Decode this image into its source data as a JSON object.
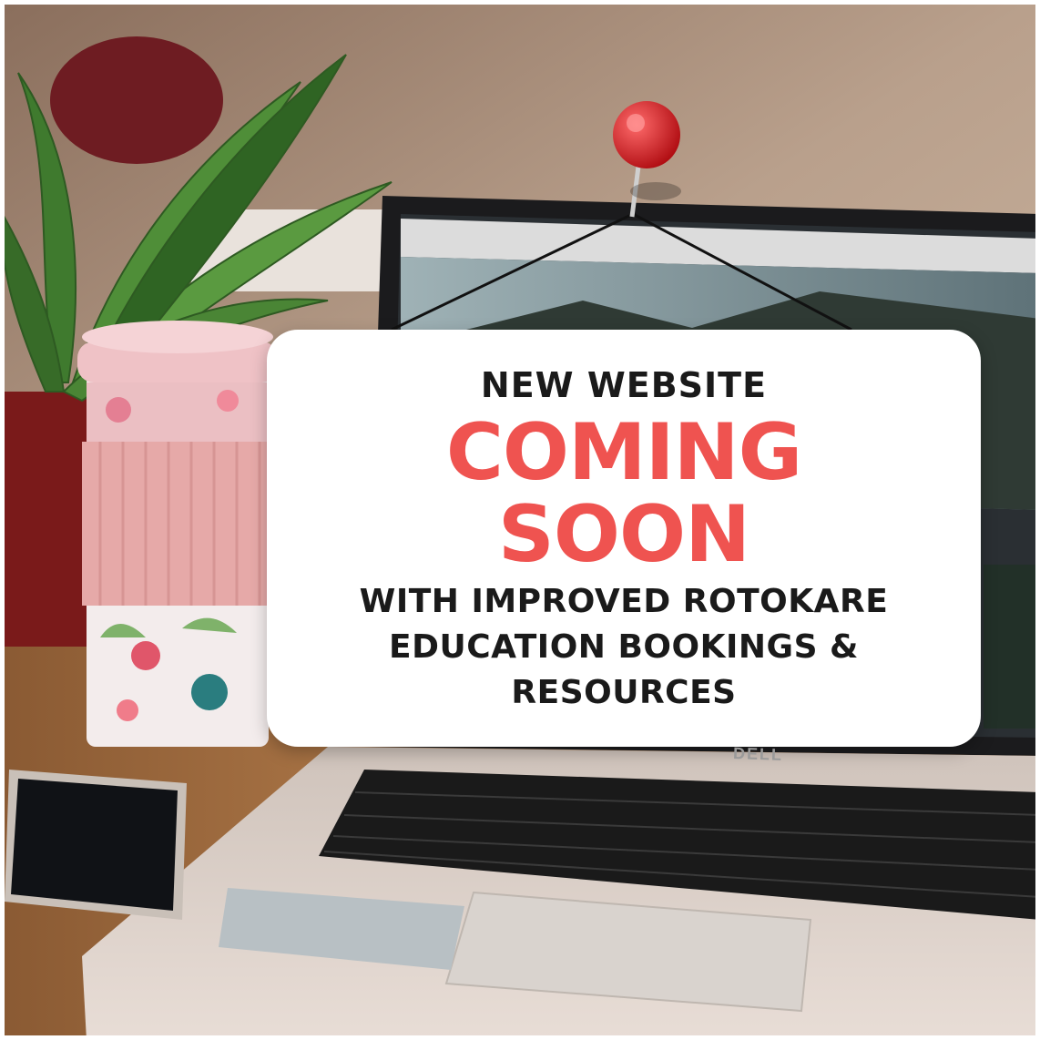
{
  "poster": {
    "line_top": "NEW WEBSITE",
    "headline_1": "COMING",
    "headline_2": "SOON",
    "line_bottom": [
      "WITH IMPROVED ROTOKARE",
      "EDUCATION BOOKINGS &",
      "RESOURCES"
    ],
    "laptop_brand": "DELL"
  },
  "colors": {
    "text_dark": "#1a1a1a",
    "accent_red": "#ef5350",
    "card_bg": "#ffffff"
  },
  "icons": [
    "red-push-pin",
    "plant",
    "coffee-cup",
    "smartphone",
    "laptop"
  ]
}
